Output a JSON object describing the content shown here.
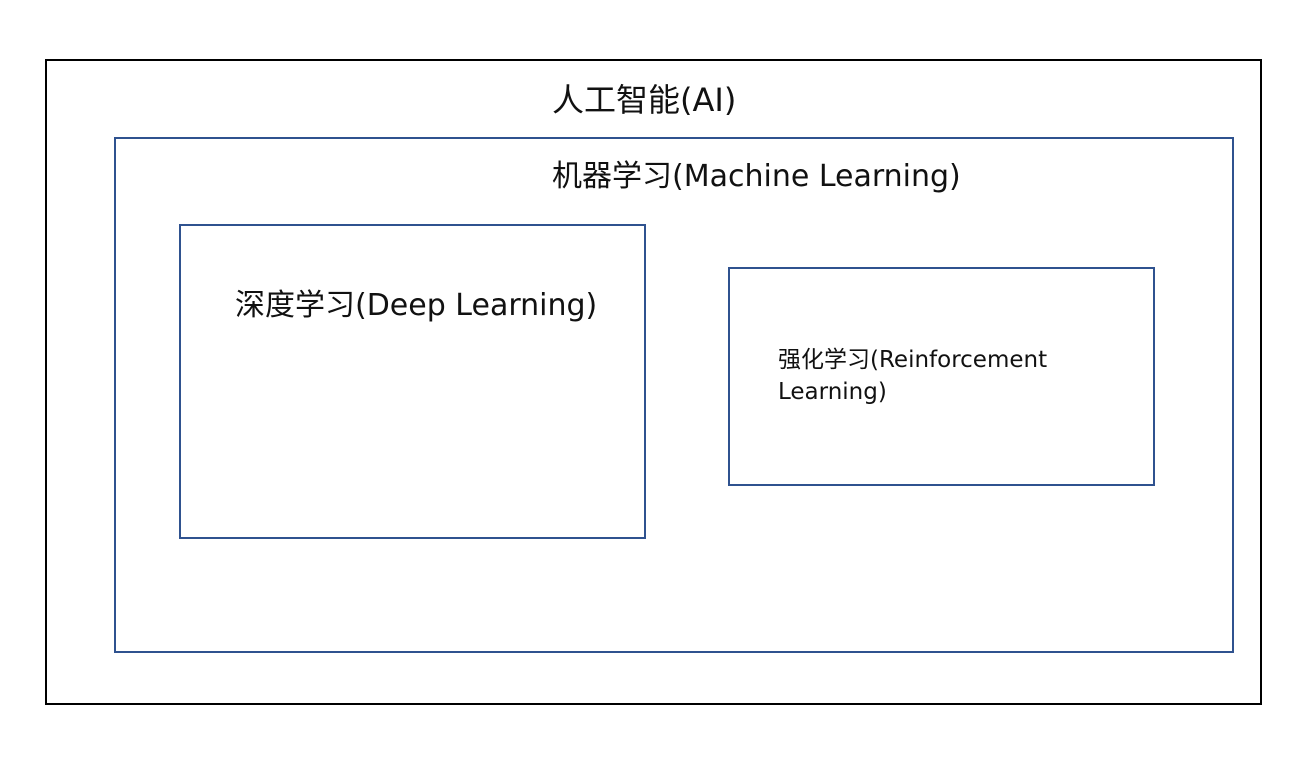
{
  "diagram": {
    "ai": {
      "label": "人工智能(AI)"
    },
    "machine_learning": {
      "label": "机器学习(Machine Learning)"
    },
    "deep_learning": {
      "label": "深度学习(Deep Learning)"
    },
    "reinforcement_learning": {
      "label_line1": "强化学习(Reinforcement",
      "label_line2": "Learning)"
    }
  },
  "colors": {
    "outer_border": "#000000",
    "inner_border": "#2f528f",
    "background": "#ffffff"
  }
}
